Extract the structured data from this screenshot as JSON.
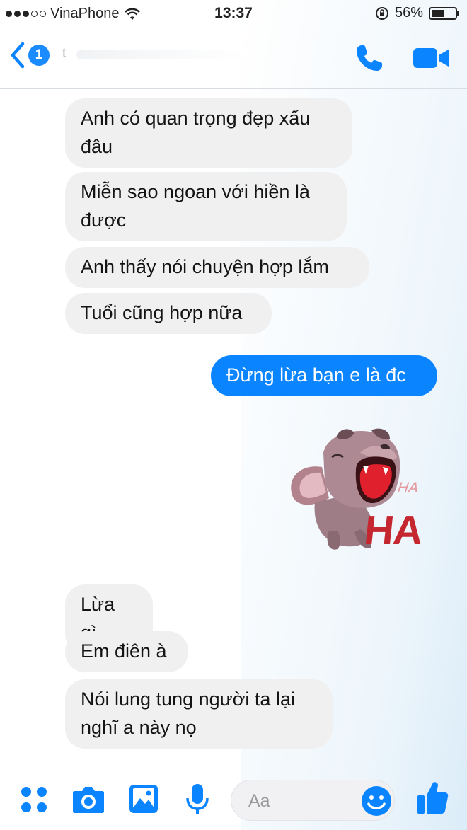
{
  "status_bar": {
    "carrier": "VinaPhone",
    "time": "13:37",
    "battery_percent": "56%",
    "battery_level": 0.56,
    "signal_bars_filled": 3,
    "signal_bars_total": 5
  },
  "header": {
    "unread_count": "1",
    "contact_name": "t"
  },
  "messages": [
    {
      "direction": "in",
      "text": "Anh có quan trọng đẹp xấu\nđâu"
    },
    {
      "direction": "in",
      "text": "Miễn sao ngoan với hiền là\nđược"
    },
    {
      "direction": "in",
      "text": "Anh thấy nói chuyện hợp lắm"
    },
    {
      "direction": "in",
      "text": "Tuổi cũng hợp nữa"
    },
    {
      "direction": "out",
      "text": "Đừng lừa bạn e là đc"
    },
    {
      "direction": "in",
      "text": "Lừa gì"
    },
    {
      "direction": "in",
      "text": "Em điên à"
    },
    {
      "direction": "in",
      "text": "Nói lung tung người ta lại\nnghĩ a này nọ"
    }
  ],
  "sticker": {
    "icon": "laughing-dog-sticker",
    "big_text": "HA",
    "small_text": "HA"
  },
  "composer": {
    "placeholder": "Aa"
  },
  "colors": {
    "accent": "#0a84ff",
    "incoming_bubble": "#f1f0f0",
    "sticker_red": "#c4272f"
  }
}
